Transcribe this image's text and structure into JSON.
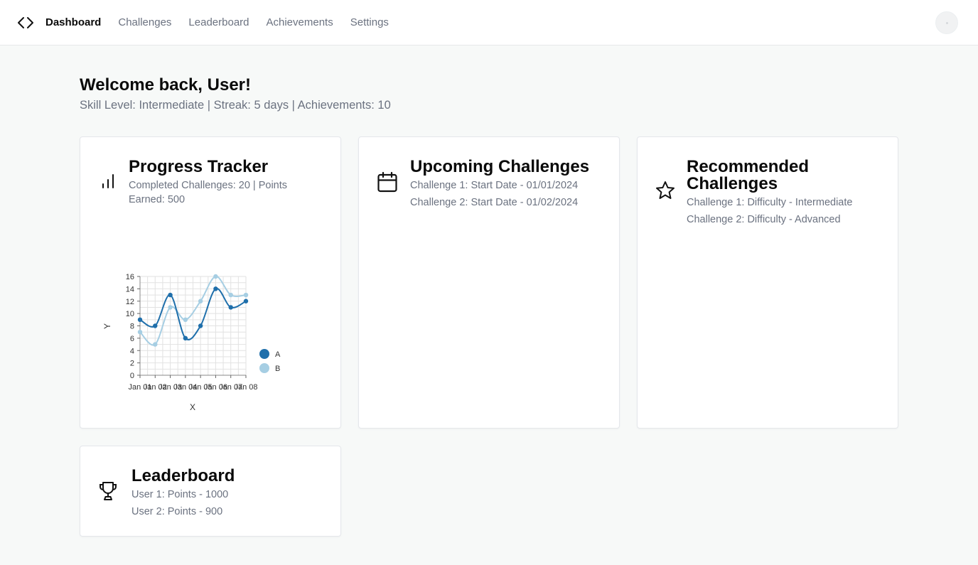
{
  "nav": {
    "logo_icon": "code-brackets-icon",
    "items": [
      {
        "label": "Dashboard",
        "active": true
      },
      {
        "label": "Challenges",
        "active": false
      },
      {
        "label": "Leaderboard",
        "active": false
      },
      {
        "label": "Achievements",
        "active": false
      },
      {
        "label": "Settings",
        "active": false
      }
    ],
    "avatar_icon": "user-avatar-icon"
  },
  "header": {
    "title": "Welcome back, User!",
    "subtitle": "Skill Level: Intermediate | Streak: 5 days | Achievements: 10"
  },
  "cards": {
    "progress": {
      "icon": "bar-chart-icon",
      "title": "Progress Tracker",
      "text": "Completed Challenges: 20 | Points Earned: 500"
    },
    "upcoming": {
      "icon": "calendar-icon",
      "title": "Upcoming Challenges",
      "lines": [
        "Challenge 1: Start Date - 01/01/2024",
        "Challenge 2: Start Date - 01/02/2024"
      ]
    },
    "recommended": {
      "icon": "star-icon",
      "title": "Recommended Challenges",
      "lines": [
        "Challenge 1: Difficulty - Intermediate",
        "Challenge 2: Difficulty - Advanced"
      ]
    },
    "leaderboard": {
      "icon": "trophy-icon",
      "title": "Leaderboard",
      "lines": [
        "User 1: Points - 1000",
        "User 2: Points - 900"
      ]
    }
  },
  "chart_data": {
    "type": "line",
    "x": [
      "Jan 01",
      "Jan 02",
      "Jan 03",
      "Jan 04",
      "Jan 05",
      "Jan 06",
      "Jan 07",
      "Jan 08"
    ],
    "series": [
      {
        "name": "A",
        "color": "#1f6fab",
        "values": [
          9,
          8,
          13,
          6,
          8,
          14,
          11,
          12
        ]
      },
      {
        "name": "B",
        "color": "#a6cee3",
        "values": [
          7,
          5,
          11,
          9,
          12,
          16,
          13,
          13
        ]
      }
    ],
    "yticks": [
      0,
      2,
      4,
      6,
      8,
      10,
      12,
      14,
      16
    ],
    "ylim": [
      0,
      16
    ],
    "xlabel": "X",
    "ylabel": "Y",
    "grid": true,
    "legend": "right"
  }
}
